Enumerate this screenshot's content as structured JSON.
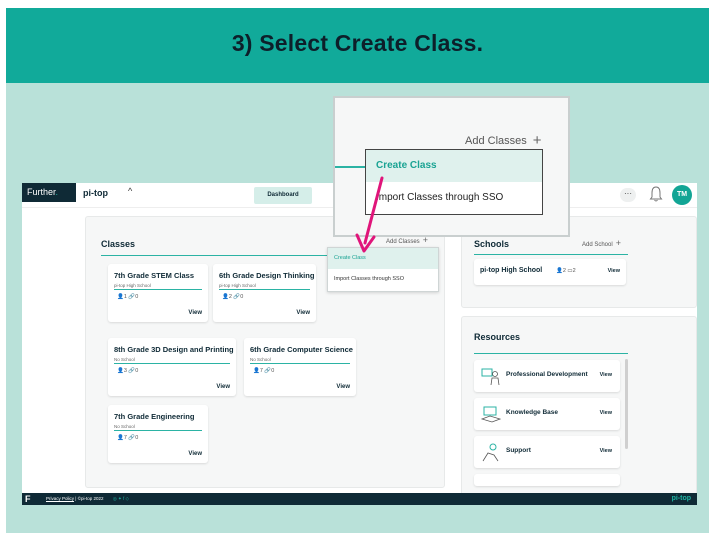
{
  "banner": {
    "title": "3) Select Create Class."
  },
  "topbar": {
    "further": "Further",
    "further_dot": ".",
    "brand": "pi-top",
    "chevron": "^",
    "dashboard": "Dashboard",
    "more": "···",
    "avatar": "TM"
  },
  "classes": {
    "title": "Classes",
    "add_label": "Add Classes",
    "dropdown": {
      "create": "Create Class",
      "import": "Import Classes through SSO"
    },
    "cards": [
      {
        "title": "7th Grade STEM Class",
        "school": "pi-top High School",
        "meta": "👤1  🔗0",
        "view": "View"
      },
      {
        "title": "6th Grade Design Thinking",
        "school": "pi-top High School",
        "meta": "👤2  🔗0",
        "view": "View"
      },
      {
        "title": "8th Grade 3D Design and Printing",
        "school": "No School",
        "meta": "👤3  🔗0",
        "view": "View"
      },
      {
        "title": "6th Grade Computer Science",
        "school": "No School",
        "meta": "👤7  🔗0",
        "view": "View"
      },
      {
        "title": "7th Grade Engineering",
        "school": "No School",
        "meta": "👤7  🔗0",
        "view": "View"
      }
    ]
  },
  "schools": {
    "title": "Schools",
    "add_label": "Add School",
    "card": {
      "name": "pi-top High School",
      "meta": "👤2  ▭2",
      "view": "View"
    }
  },
  "resources": {
    "title": "Resources",
    "items": [
      {
        "label": "Professional Development",
        "view": "View",
        "icon": "teacher-icon"
      },
      {
        "label": "Knowledge Base",
        "view": "View",
        "icon": "book-icon"
      },
      {
        "label": "Support",
        "view": "View",
        "icon": "support-icon"
      }
    ]
  },
  "footer": {
    "logo": "F",
    "privacy": "Privacy Policy",
    "copyright": "| ©pi-top 2022",
    "social": "◎ ✦ f ◇",
    "brand": "pi-top"
  },
  "zoom": {
    "add_label": "Add Classes",
    "create": "Create Class",
    "import": "Import Classes through SSO"
  },
  "colors": {
    "teal": "#11aa9a",
    "navy": "#0f2a36",
    "highlight": "#dff1ed",
    "arrow": "#e0157a"
  }
}
